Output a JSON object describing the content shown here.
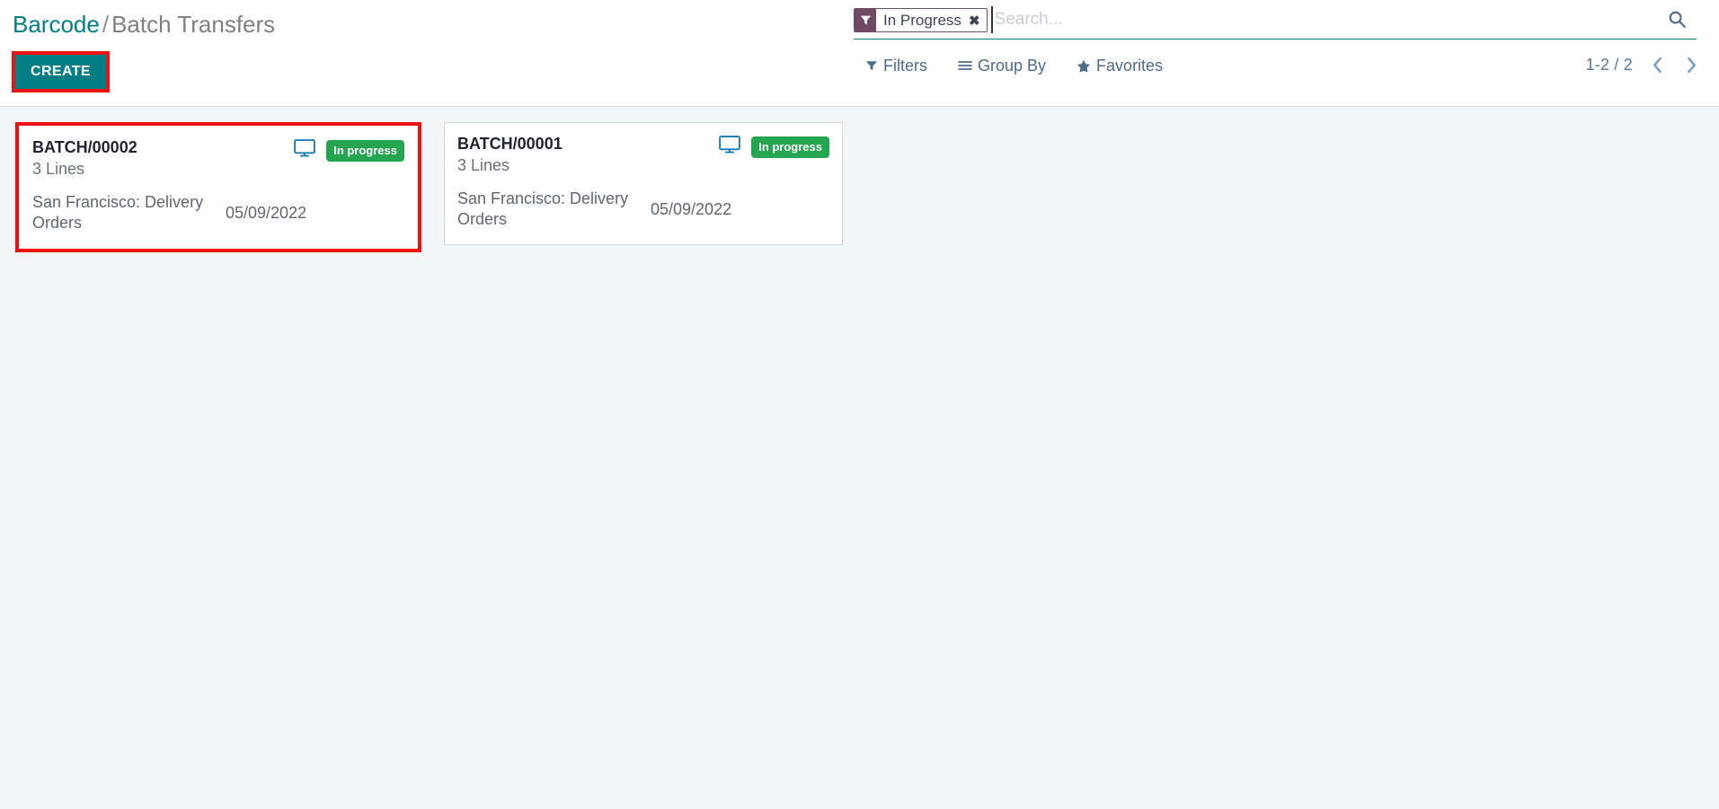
{
  "breadcrumb": {
    "root": "Barcode",
    "separator": "/",
    "current": "Batch Transfers",
    "root_color": "#017e84",
    "current_color": "#808080"
  },
  "toolbar": {
    "create_label": "CREATE",
    "create_bg": "#017e84",
    "highlight_color": "#ee1111"
  },
  "search": {
    "facet": {
      "icon": "filter-funnel-icon",
      "label": "In Progress",
      "remove_label": "✖",
      "icon_bg": "#6e4a63"
    },
    "placeholder": "Search...",
    "value": "",
    "search_icon": "magnifier-icon",
    "underline_color": "#017e84"
  },
  "filter_menus": [
    {
      "label": "Filters",
      "icon": "funnel-icon"
    },
    {
      "label": "Group By",
      "icon": "list-lines-icon"
    },
    {
      "label": "Favorites",
      "icon": "star-icon"
    }
  ],
  "pager": {
    "range": "1-2 / 2",
    "previous_icon": "chevron-left-icon",
    "next_icon": "chevron-right-icon"
  },
  "kanban": {
    "cards": [
      {
        "name": "BATCH/00002",
        "lines": "3 Lines",
        "location": "San Francisco: Delivery Orders",
        "date": "05/09/2022",
        "device_icon": "monitor-icon",
        "status": "In progress",
        "status_color": "#26a550",
        "highlighted": true
      },
      {
        "name": "BATCH/00001",
        "lines": "3 Lines",
        "location": "San Francisco: Delivery Orders",
        "date": "05/09/2022",
        "device_icon": "monitor-icon",
        "status": "In progress",
        "status_color": "#26a550",
        "highlighted": false
      }
    ]
  },
  "colors": {
    "background": "#f4f5f9",
    "panel": "#ffffff",
    "accent_teal": "#017e84",
    "accent_purple": "#6e4a63",
    "muted_blue": "#4f6b8a"
  }
}
